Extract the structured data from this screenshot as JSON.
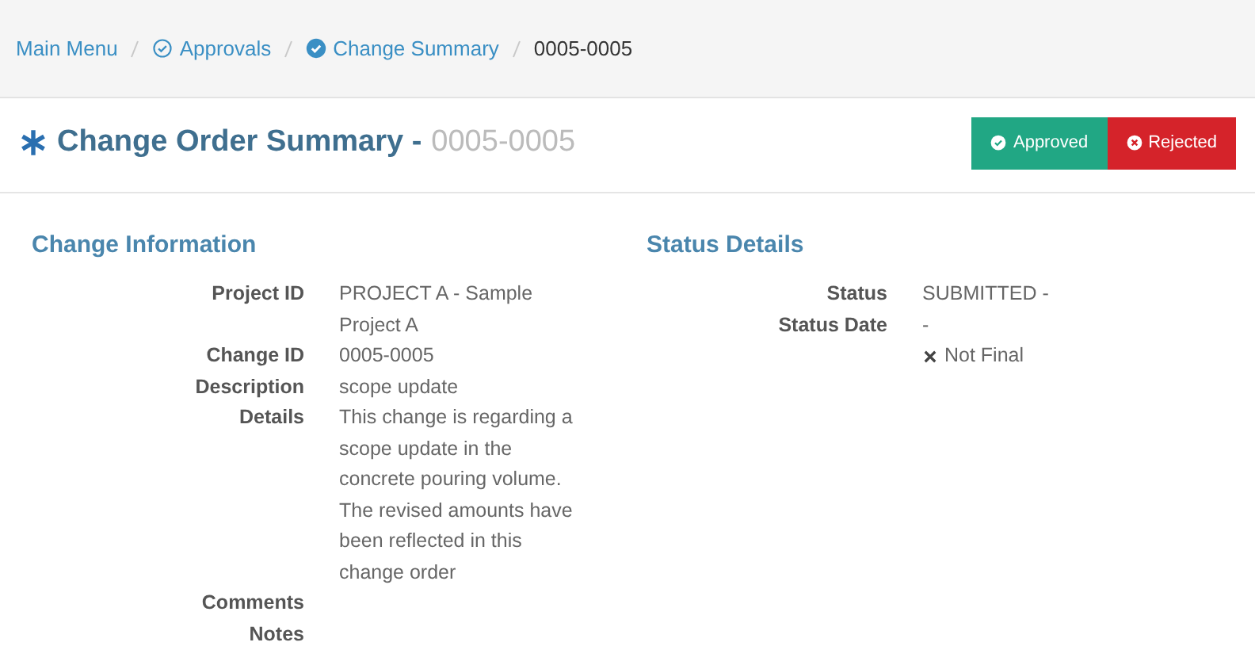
{
  "breadcrumb": [
    {
      "label": "Main Menu",
      "kind": "plain",
      "current": false
    },
    {
      "label": "Approvals",
      "kind": "outline",
      "current": false
    },
    {
      "label": "Change Summary",
      "kind": "filled",
      "current": false
    },
    {
      "label": "0005-0005",
      "kind": "plain",
      "current": true
    }
  ],
  "header": {
    "title": "Change Order Summary -",
    "code": "0005-0005"
  },
  "actions": [
    {
      "label": "Approved",
      "kind": "approve"
    },
    {
      "label": "Rejected",
      "kind": "reject"
    }
  ],
  "sections": [
    {
      "title": "Change Information",
      "fields": [
        {
          "label": "Project ID",
          "value": "PROJECT A - Sample Project A"
        },
        {
          "label": "Change ID",
          "value": "0005-0005"
        },
        {
          "label": "Description",
          "value": "scope update"
        },
        {
          "label": "Details",
          "value": "This change is regarding a scope update in the concrete pouring volume. The revised amounts have been reflected in this change order"
        },
        {
          "label": "Comments"
        },
        {
          "label": "Notes"
        }
      ]
    },
    {
      "title": "Status Details",
      "fields": [
        {
          "label": "Status",
          "value": "SUBMITTED -"
        },
        {
          "label": "Status Date",
          "value": "-"
        }
      ],
      "final": {
        "label": "Not Final",
        "final": false
      }
    }
  ]
}
